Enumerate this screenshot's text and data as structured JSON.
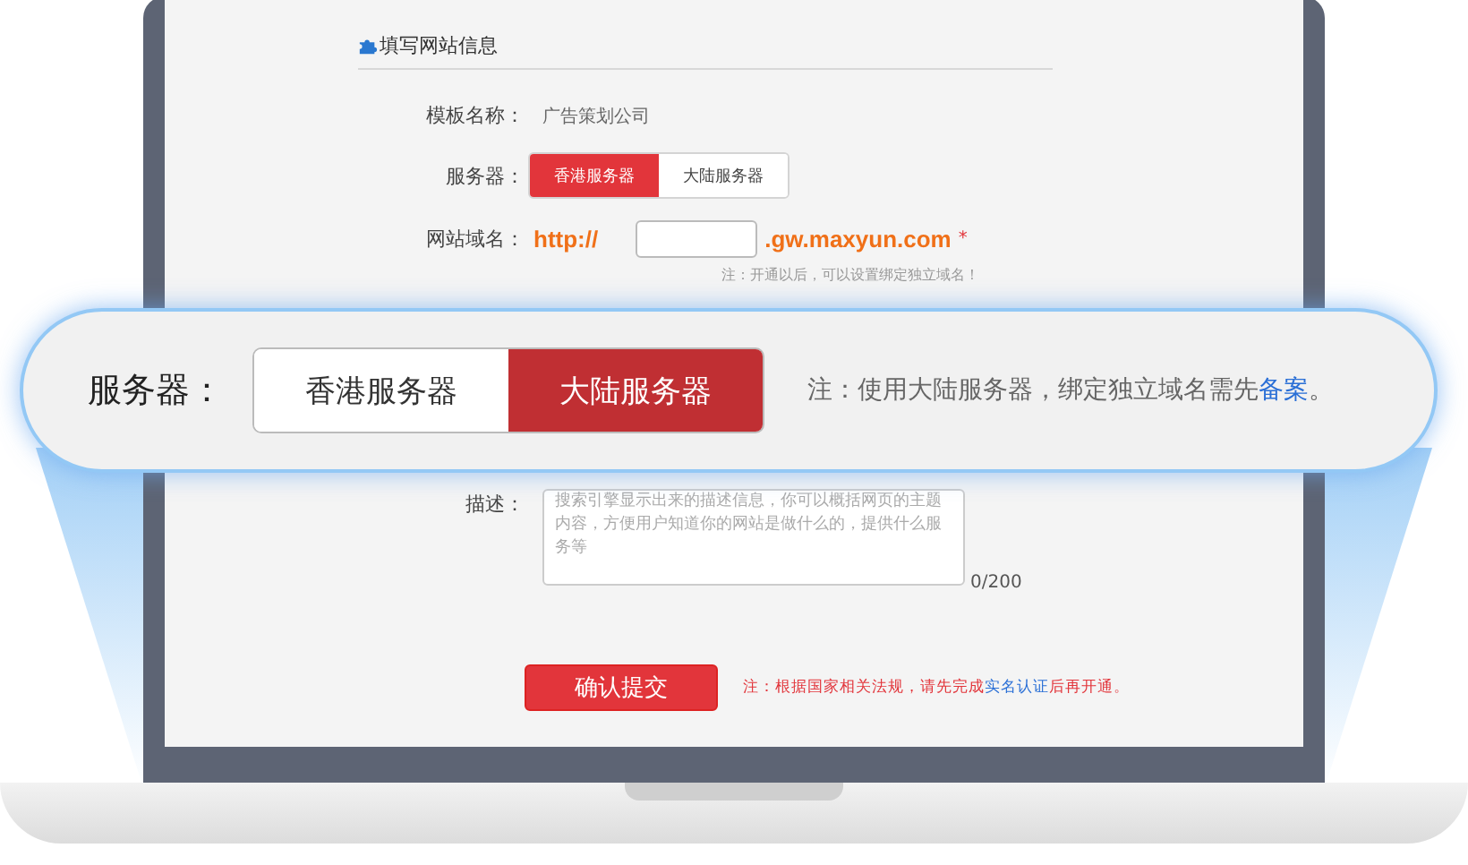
{
  "section_title": "填写网站信息",
  "fields": [
    {
      "kind": "text",
      "label": "模板名称：",
      "value": "广告策划公司"
    },
    {
      "kind": "toggle",
      "label": "服务器：",
      "options": [
        {
          "label": "香港服务器",
          "selected": true
        },
        {
          "label": "大陆服务器",
          "selected": false
        }
      ]
    },
    {
      "kind": "domain",
      "label": "网站域名：",
      "prefix": "http://",
      "suffix": ".gw.maxyun.com",
      "required_mark": "*",
      "note": "注：开通以后，可以设置绑定独立域名！"
    },
    {
      "kind": "textarea",
      "label": "描述：",
      "placeholder": "搜索引擎显示出来的描述信息，你可以概括网页的主题内容，方便用户知道你的网站是做什么的，提供什么服务等",
      "counter": "0/200"
    }
  ],
  "submit": {
    "label": "确认提交",
    "note": "注：根据国家相关法规，请先完成",
    "link": "实名认证",
    "note_end": "后再开通。"
  },
  "callout": {
    "label": "服务器：",
    "options": [
      {
        "label": "香港服务器",
        "selected": false
      },
      {
        "label": "大陆服务器",
        "selected": true
      }
    ],
    "note": "注：使用大陆服务器，绑定独立域名需先",
    "link": "备案",
    "note_end": "。"
  }
}
